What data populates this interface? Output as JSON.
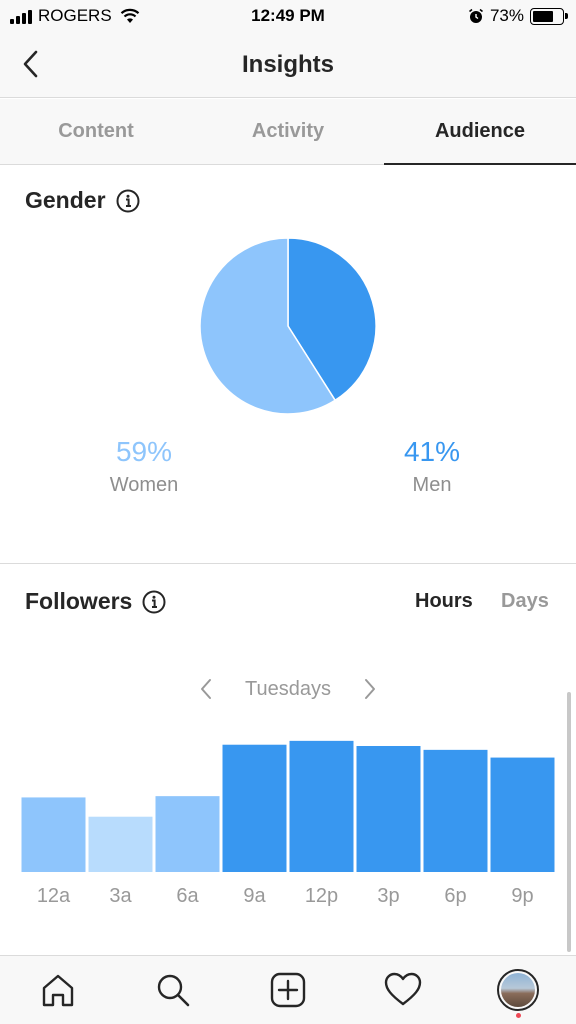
{
  "status_bar": {
    "carrier": "ROGERS",
    "time": "12:49 PM",
    "battery": "73%",
    "battery_level": 0.73
  },
  "header": {
    "title": "Insights",
    "back_icon": "chevron-left-icon"
  },
  "tabs": [
    {
      "label": "Content",
      "active": false
    },
    {
      "label": "Activity",
      "active": false
    },
    {
      "label": "Audience",
      "active": true
    }
  ],
  "gender": {
    "title": "Gender",
    "women_percent": "59%",
    "women_label": "Women",
    "men_percent": "41%",
    "men_label": "Men"
  },
  "followers": {
    "title": "Followers",
    "toggle_hours": "Hours",
    "toggle_days": "Days",
    "selected_day": "Tuesdays"
  },
  "colors": {
    "women": "#8ec5fc",
    "men": "#3897f0",
    "bar_light": "#b8dcfd",
    "bar_mid": "#8ec5fc",
    "bar_dark": "#3897f0"
  },
  "chart_data": [
    {
      "type": "pie",
      "categories": [
        "Women",
        "Men"
      ],
      "values": [
        59,
        41
      ],
      "colors": [
        "#8ec5fc",
        "#3897f0"
      ]
    },
    {
      "type": "bar",
      "categories": [
        "12a",
        "3a",
        "6a",
        "9a",
        "12p",
        "3p",
        "6p",
        "9p"
      ],
      "values": [
        58,
        43,
        59,
        99,
        102,
        98,
        95,
        89
      ],
      "ylim": [
        0,
        105
      ],
      "bar_colors": [
        "#8ec5fc",
        "#b8dcfd",
        "#8ec5fc",
        "#3897f0",
        "#3897f0",
        "#3897f0",
        "#3897f0",
        "#3897f0"
      ]
    }
  ],
  "bottom_nav": [
    {
      "name": "home-icon"
    },
    {
      "name": "search-icon"
    },
    {
      "name": "add-post-icon"
    },
    {
      "name": "heart-icon"
    },
    {
      "name": "profile-avatar"
    }
  ]
}
